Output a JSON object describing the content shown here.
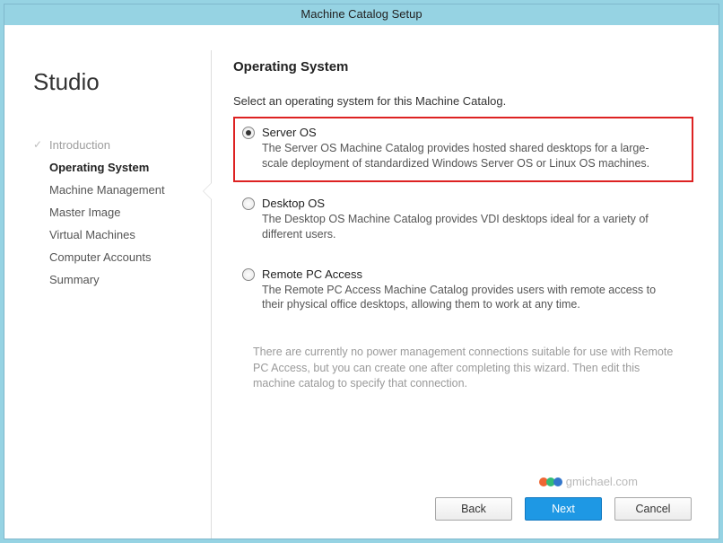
{
  "window": {
    "title": "Machine Catalog Setup"
  },
  "sidebar": {
    "title": "Studio",
    "steps": [
      {
        "label": "Introduction",
        "state": "done"
      },
      {
        "label": "Operating System",
        "state": "current"
      },
      {
        "label": "Machine Management",
        "state": "pending"
      },
      {
        "label": "Master Image",
        "state": "pending"
      },
      {
        "label": "Virtual Machines",
        "state": "pending"
      },
      {
        "label": "Computer Accounts",
        "state": "pending"
      },
      {
        "label": "Summary",
        "state": "pending"
      }
    ]
  },
  "main": {
    "heading": "Operating System",
    "instruction": "Select an operating system for this Machine Catalog.",
    "options": [
      {
        "id": "server-os",
        "title": "Server OS",
        "desc": "The Server OS Machine Catalog provides hosted shared desktops for a large-scale deployment of standardized Windows Server OS or Linux OS machines.",
        "selected": true,
        "highlighted": true
      },
      {
        "id": "desktop-os",
        "title": "Desktop OS",
        "desc": "The Desktop OS Machine Catalog provides VDI desktops ideal for a variety of different users.",
        "selected": false,
        "highlighted": false
      },
      {
        "id": "remote-pc",
        "title": "Remote PC Access",
        "desc": "The Remote PC Access Machine Catalog provides users with remote access to their physical office desktops, allowing them to work at any time.",
        "selected": false,
        "highlighted": false
      }
    ],
    "note": "There are currently no power management connections suitable for use with Remote PC Access, but you can create one after completing this wizard. Then edit this machine catalog to specify that connection."
  },
  "watermark": {
    "text": "gmichael.com"
  },
  "footer": {
    "back": "Back",
    "next": "Next",
    "cancel": "Cancel"
  }
}
